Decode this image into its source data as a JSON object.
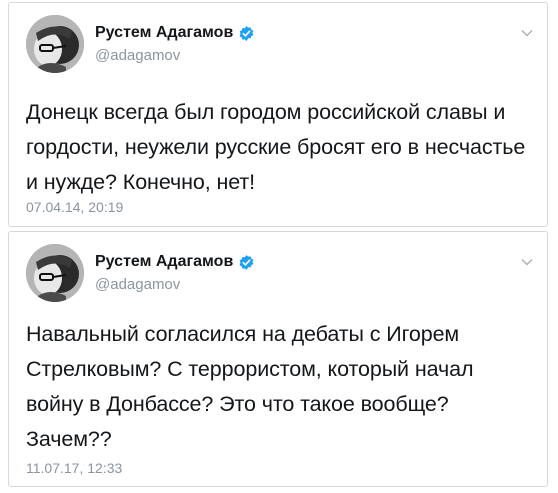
{
  "tweets": [
    {
      "author_name": "Рустем Адагамов",
      "handle": "@adagamov",
      "text": "Донецк всегда был городом российской славы и гордости, неужели русские бросят его в несчастье и нужде? Конечно, нет!",
      "timestamp": "07.04.14, 20:19"
    },
    {
      "author_name": "Рустем Адагамов",
      "handle": "@adagamov",
      "text": "Навальный согласился на дебаты с Игорем Стрелковым? С террористом, который начал войну в Донбассе? Это что такое вообще? Зачем??",
      "timestamp": "11.07.17, 12:33"
    }
  ],
  "icons": {
    "verified": "verified-badge-icon",
    "menu": "chevron-down-icon"
  },
  "colors": {
    "verified_badge": "#1da1f2",
    "secondary_text": "#8a959e",
    "primary_text": "#14171a",
    "card_border": "#d6d9dc"
  }
}
